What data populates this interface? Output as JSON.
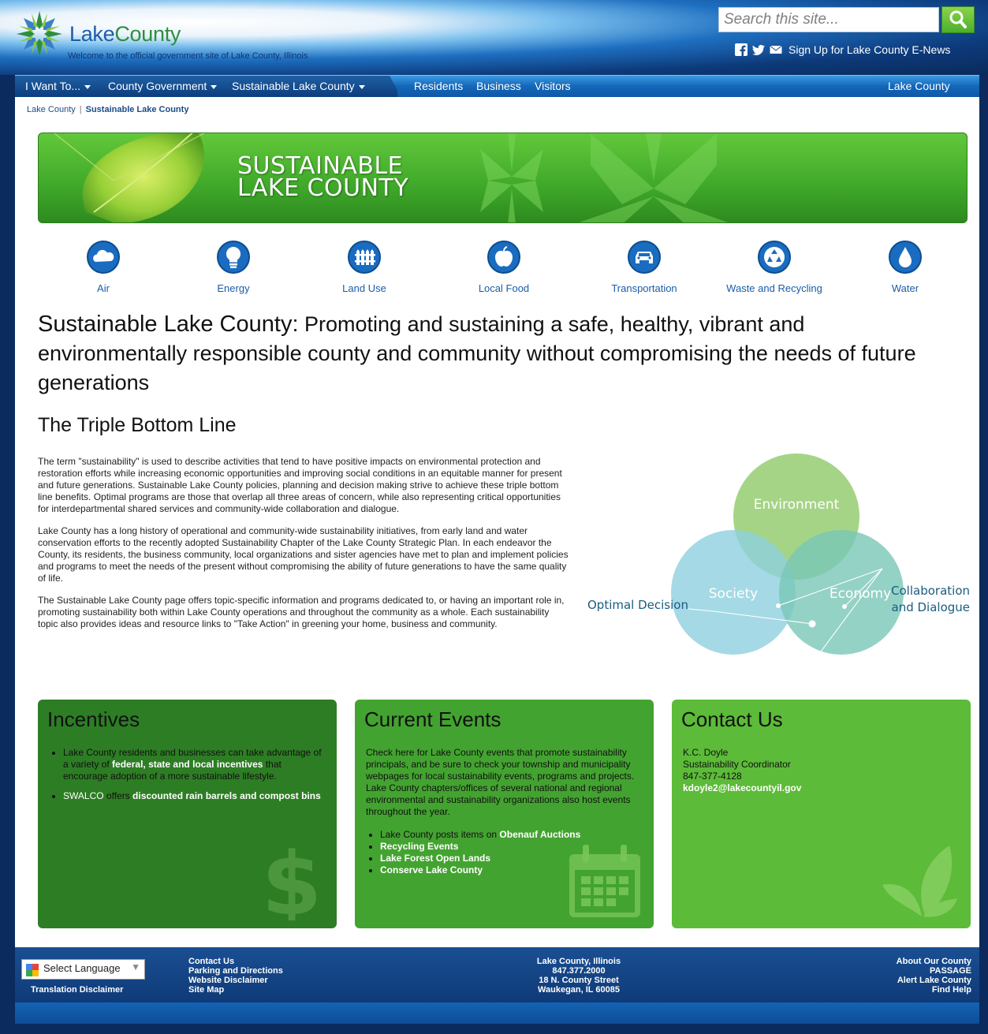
{
  "header": {
    "logo_text_lake": "Lake",
    "logo_text_county": "County",
    "tagline": "Welcome to the official government site of Lake County, Illinois",
    "search_placeholder": "Search this site...",
    "enews_label": "Sign Up for Lake County E-News"
  },
  "nav": {
    "i_want_to": "I Want To...",
    "county_government": "County Government",
    "sustainable": "Sustainable Lake County",
    "residents": "Residents",
    "business": "Business",
    "visitors": "Visitors",
    "lake_county": "Lake County"
  },
  "breadcrumb": {
    "home": "Lake County",
    "separator": "|",
    "current": "Sustainable Lake County"
  },
  "banner": {
    "line1": "SUSTAINABLE",
    "line2": "LAKE COUNTY"
  },
  "topics": [
    {
      "label": "Air",
      "icon": "cloud-icon"
    },
    {
      "label": "Energy",
      "icon": "lightbulb-icon"
    },
    {
      "label": "Land Use",
      "icon": "fence-icon"
    },
    {
      "label": "Local Food",
      "icon": "apple-icon"
    },
    {
      "label": "Transportation",
      "icon": "car-icon"
    },
    {
      "label": "Waste and Recycling",
      "icon": "recycle-icon"
    },
    {
      "label": "Water",
      "icon": "water-drop-icon"
    }
  ],
  "headline": {
    "lead": "Sustainable Lake County:",
    "rest": "Promoting and sustaining a safe, healthy, vibrant and environmentally responsible county and community without compromising the needs of future generations"
  },
  "subhead": "The Triple Bottom Line",
  "paragraphs": [
    "The term \"sustainability\" is used to describe activities that tend to have positive impacts on environmental protection and restoration efforts while increasing economic opportunities and improving social conditions in an equitable manner for present and future generations. Sustainable Lake County policies, planning and decision making strive to achieve these triple bottom line benefits. Optimal programs are those that overlap all three areas of concern, while also representing critical opportunities for interdepartmental shared services and community-wide collaboration and dialogue.",
    "Lake County has a long history of operational and community-wide sustainability initiatives, from early land and water conservation efforts to the recently adopted Sustainability Chapter of the Lake County Strategic Plan. In each endeavor the County, its residents, the business community, local organizations and sister agencies have met to plan and implement policies and programs to meet the needs of the present without compromising the ability of future generations to have the same quality of life.",
    "The Sustainable Lake County page offers topic-specific information and programs dedicated to, or having an important role in, promoting sustainability both within Lake County operations and throughout the community as a whole. Each sustainability topic also provides ideas and resource links to \"Take Action\" in greening your home, business and community."
  ],
  "venn": {
    "environment": "Environment",
    "society": "Society",
    "economy": "Economy",
    "optimal": "Optimal Decision",
    "collab_line1": "Collaboration",
    "collab_line2": "and Dialogue"
  },
  "incentives": {
    "title": "Incentives",
    "item1_pre": "Lake County residents and businesses can take advantage of a variety of",
    "item1_link": "federal, state and local incentives",
    "item1_post": "that encourage adoption of a more sustainable lifestyle.",
    "item2_pre": "SWALCO",
    "item2_mid": "offers",
    "item2_link": "discounted rain barrels and compost bins"
  },
  "events": {
    "title": "Current Events",
    "intro": "Check here for Lake County events that promote sustainability principals, and be sure to check your township and municipality webpages for local sustainability events, programs and projects. Lake County chapters/offices of several national and regional environmental and sustainability organizations also host events throughout the year.",
    "item1_pre": "Lake County posts items on",
    "item1_link": "Obenauf Auctions",
    "item2": "Recycling Events",
    "item3": "Lake Forest Open Lands",
    "item4": "Conserve Lake County"
  },
  "contact": {
    "title": "Contact Us",
    "name": "K.C. Doyle",
    "role": "Sustainability Coordinator",
    "phone": "847-377-4128",
    "email": "kdoyle2@lakecountyil.gov"
  },
  "footer": {
    "select_language": "Select Language",
    "translation_disclaimer": "Translation Disclaimer",
    "links": [
      "Contact Us",
      "Parking and Directions",
      "Website Disclaimer",
      "Site Map"
    ],
    "address": [
      "Lake County, Illinois",
      "847.377.2000",
      "18 N. County Street",
      "Waukegan, IL 60085"
    ],
    "right_links": [
      "About Our County",
      "PASSAGE",
      "Alert Lake County",
      "Find Help"
    ]
  }
}
